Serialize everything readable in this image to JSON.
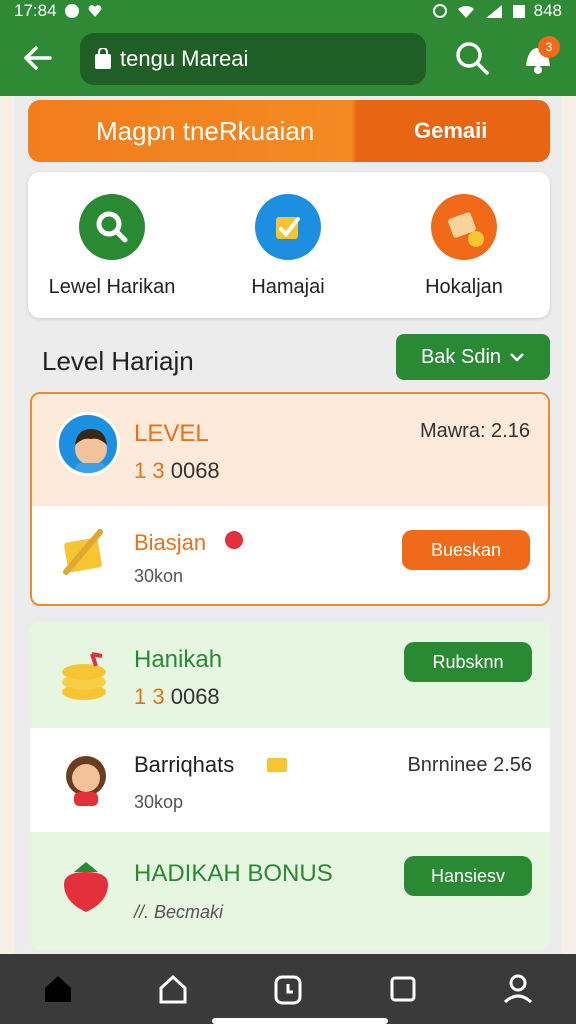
{
  "status_bar": {
    "time": "17:84",
    "battery": "848"
  },
  "app_bar": {
    "search_text": "tengu Mareai",
    "notif_count": "3"
  },
  "banner": {
    "title": "Magpn tneRkuaian",
    "button": "Gemaii"
  },
  "shortcuts": [
    {
      "label": "Lewel Harikan",
      "icon": "search-icon",
      "color": "#2a8a34"
    },
    {
      "label": "Hamajai",
      "icon": "edit-icon",
      "color": "#1d8fe0"
    },
    {
      "label": "Hokaljan",
      "icon": "coupon-icon",
      "color": "#f06a1a"
    }
  ],
  "section": {
    "title": "Level Hariajn",
    "button": "Bak Sdin"
  },
  "level_card": {
    "name": "LEVEL",
    "sub_accent": "1 3",
    "sub_rest": "0068",
    "right": "Mawra: 2.16",
    "task_name": "Biasjan",
    "task_sub": "30kon",
    "task_button": "Bueskan"
  },
  "list": [
    {
      "title": "Hanikah",
      "sub_accent": "1 3",
      "sub_rest": "0068",
      "button": "Rubsknn",
      "icon": "coins-icon"
    },
    {
      "title": "Barriqhats",
      "sub": "30kop",
      "right": "Bnrninee 2.56",
      "icon": "avatar-girl-icon"
    },
    {
      "title": "HADIKAH BONUS",
      "sub": "//. Becmaki",
      "button": "Hansiesv",
      "icon": "strawberry-icon"
    }
  ],
  "colors": {
    "primary_green": "#2f8a35",
    "accent_orange": "#f06a1a"
  }
}
